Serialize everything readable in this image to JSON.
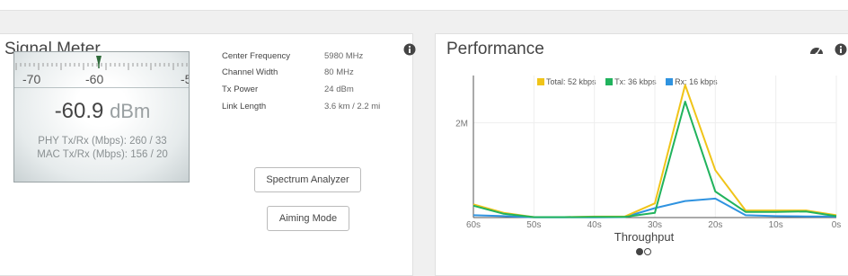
{
  "signal_meter": {
    "title": "Signal Meter",
    "scale_labels": [
      "-70",
      "-60",
      "-5"
    ],
    "reading_value": "-60.9",
    "reading_unit": "dBm",
    "phy_label": "PHY Tx/Rx (Mbps):",
    "phy_value": "260 / 33",
    "mac_label": "MAC Tx/Rx (Mbps):",
    "mac_value": "156 / 20",
    "info": [
      {
        "key": "Center Frequency",
        "value": "5980 MHz"
      },
      {
        "key": "Channel Width",
        "value": "80 MHz"
      },
      {
        "key": "Tx Power",
        "value": "24 dBm"
      },
      {
        "key": "Link Length",
        "value": "3.6 km / 2.2 mi"
      }
    ],
    "spectrum_button": "Spectrum Analyzer",
    "aiming_button": "Aiming Mode",
    "icons": {
      "info": "info-icon"
    }
  },
  "performance": {
    "title": "Performance",
    "icons": {
      "settings": "speedometer-icon",
      "info": "info-icon"
    },
    "legend": [
      {
        "label": "Total: 52 kbps",
        "color": "#f0c419"
      },
      {
        "label": "Tx: 36 kbps",
        "color": "#21b35d"
      },
      {
        "label": "Rx: 16 kbps",
        "color": "#2f93e0"
      }
    ],
    "pager": {
      "pages": 2,
      "active": 1
    }
  },
  "chart_data": {
    "type": "line",
    "title": "",
    "xlabel": "Throughput",
    "ylabel": "",
    "x": [
      60,
      55,
      50,
      45,
      40,
      35,
      30,
      25,
      20,
      15,
      10,
      5,
      0
    ],
    "x_tick_labels": [
      "60s",
      "50s",
      "40s",
      "30s",
      "20s",
      "10s",
      "0s"
    ],
    "x_ticks": [
      60,
      50,
      40,
      30,
      20,
      10,
      0
    ],
    "y_tick_labels": [
      "2M"
    ],
    "y_ticks": [
      2000000
    ],
    "ylim": [
      0,
      3000000
    ],
    "grid": true,
    "series": [
      {
        "name": "Total: 52 kbps",
        "color": "#f0c419",
        "values": [
          280000,
          100000,
          10000,
          10000,
          20000,
          20000,
          300000,
          2800000,
          1000000,
          150000,
          150000,
          150000,
          50000
        ]
      },
      {
        "name": "Tx: 36 kbps",
        "color": "#21b35d",
        "values": [
          250000,
          80000,
          10000,
          10000,
          15000,
          15000,
          100000,
          2450000,
          550000,
          120000,
          120000,
          130000,
          30000
        ]
      },
      {
        "name": "Rx: 16 kbps",
        "color": "#2f93e0",
        "values": [
          50000,
          30000,
          5000,
          5000,
          5000,
          10000,
          200000,
          350000,
          400000,
          50000,
          30000,
          25000,
          20000
        ]
      }
    ]
  }
}
